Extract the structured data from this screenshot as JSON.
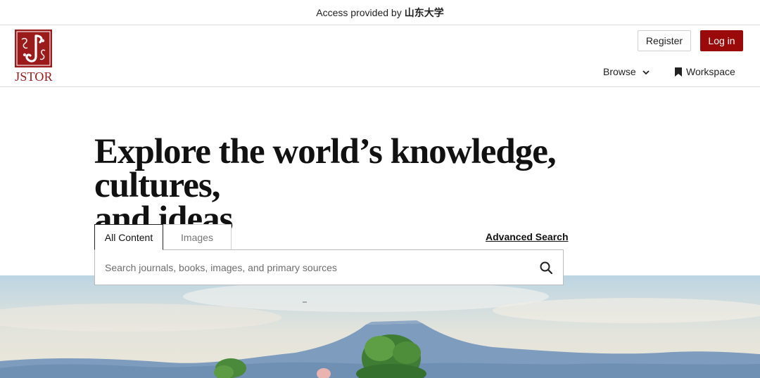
{
  "access_bar": {
    "prefix": "Access provided by",
    "institution": "山东大学"
  },
  "logo": {
    "wordmark": "JSTOR",
    "icon": "jstor-logo-icon",
    "brand_color": "#9b1a1a"
  },
  "header": {
    "register_label": "Register",
    "login_label": "Log in",
    "browse_label": "Browse",
    "workspace_label": "Workspace",
    "accent_color": "#9b0a0a"
  },
  "hero": {
    "title_line1": "Explore the world’s knowledge, cultures,",
    "title_line2": "and ideas"
  },
  "search": {
    "tabs": [
      {
        "label": "All Content",
        "selected": true
      },
      {
        "label": "Images",
        "selected": false
      }
    ],
    "advanced_label": "Advanced Search",
    "placeholder": "Search journals, books, images, and primary sources",
    "value": "",
    "icon": "search-icon"
  },
  "icons": {
    "browse": "chevron-down-icon",
    "workspace": "bookmark-icon"
  }
}
